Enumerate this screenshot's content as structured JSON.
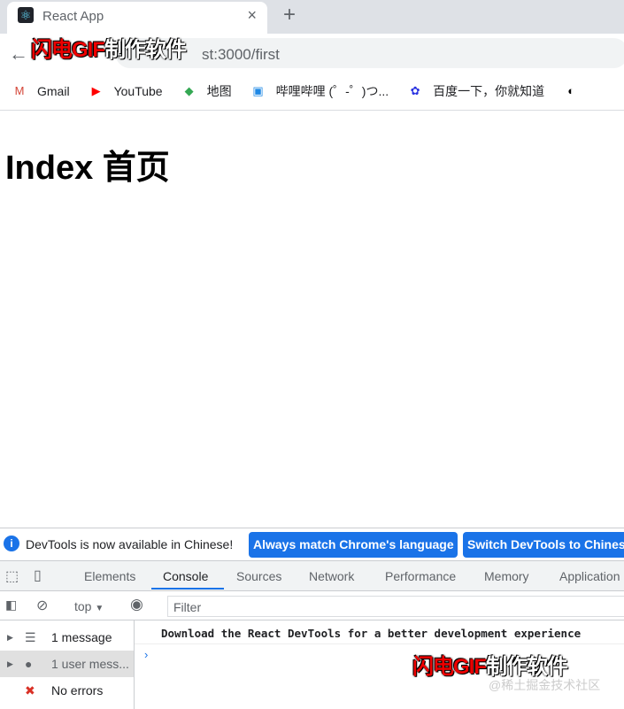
{
  "browser": {
    "tab_title": "React App",
    "tab_close": "×",
    "new_tab": "+",
    "back": "←",
    "url": "st:3000/first"
  },
  "bookmarks": [
    {
      "label": "Gmail",
      "icon": "gmail-icon",
      "glyph": "M",
      "color": "#d44638"
    },
    {
      "label": "YouTube",
      "icon": "youtube-icon",
      "glyph": "▶",
      "color": "#ff0000"
    },
    {
      "label": "地图",
      "icon": "maps-icon",
      "glyph": "◆",
      "color": "#34a853"
    },
    {
      "label": "哔哩哔哩 (゜-゜)つ...",
      "icon": "bilibili-icon",
      "glyph": "▣",
      "color": "#1e88e5"
    },
    {
      "label": "百度一下，你就知道",
      "icon": "baidu-icon",
      "glyph": "✿",
      "color": "#2932e1"
    },
    {
      "label": "",
      "icon": "juejin-icon",
      "glyph": "◐",
      "color": "#000"
    }
  ],
  "page": {
    "heading": "Index 首页"
  },
  "devtools": {
    "info_message": "DevTools is now available in Chinese!",
    "btn_match": "Always match Chrome's language",
    "btn_switch": "Switch DevTools to Chinese",
    "tabs": [
      "Elements",
      "Console",
      "Sources",
      "Network",
      "Performance",
      "Memory",
      "Application"
    ],
    "active_tab": "Console",
    "context": "top",
    "filter_placeholder": "Filter",
    "sidebar": [
      {
        "label": "1 message",
        "icon": "list-icon"
      },
      {
        "label": "1 user mess...",
        "icon": "user-icon"
      },
      {
        "label": "No errors",
        "icon": "error-icon"
      }
    ],
    "console_message": "Download the React DevTools for a better development experience",
    "prompt": "›"
  },
  "watermarks": {
    "gif_red": "闪电GIF",
    "gif_white": "制作软件",
    "juejin": "@稀土掘金技术社区"
  },
  "colors": {
    "accent": "#1a73e8",
    "error": "#d93025"
  }
}
